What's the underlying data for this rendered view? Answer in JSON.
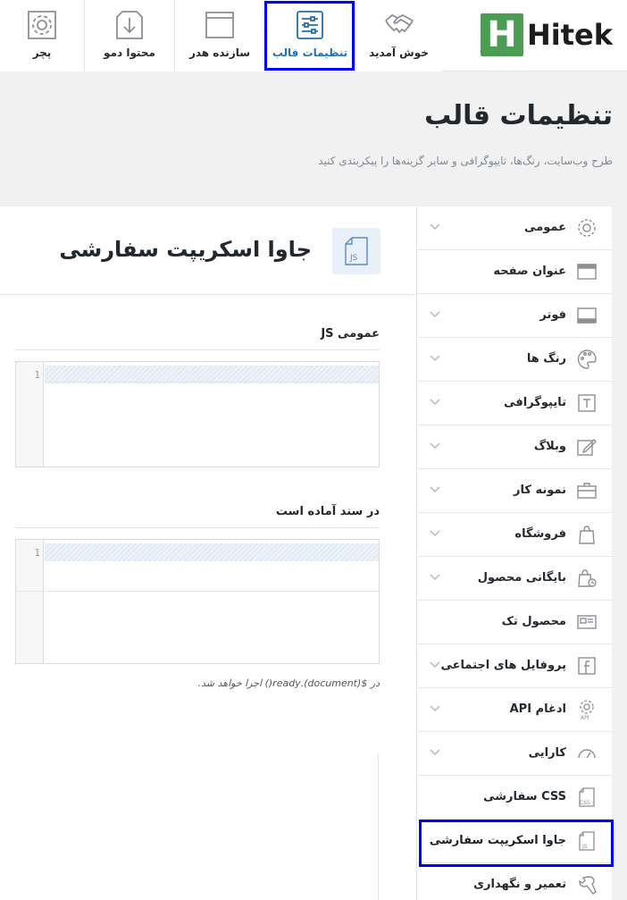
{
  "brand": {
    "logo_mark": "H",
    "logo_text": "Hitek",
    "color": "#4a9d52"
  },
  "nav": {
    "tabs": [
      {
        "id": "welcome",
        "label": "خوش آمدید",
        "icon": "handshake-icon"
      },
      {
        "id": "theme-settings",
        "label": "تنظیمات قالب",
        "icon": "sliders-icon",
        "active": true
      },
      {
        "id": "header-builder",
        "label": "سازنده هدر",
        "icon": "window-icon"
      },
      {
        "id": "demo-content",
        "label": "محتوا دمو",
        "icon": "download-icon"
      },
      {
        "id": "plugins",
        "label": "پچر",
        "icon": "gear-icon"
      }
    ]
  },
  "header": {
    "title": "تنظیمات قالب",
    "subtitle": "طرح وب‌سایت، رنگ‌ها، تایپوگرافی و سایر گزینه‌ها را پیکربندی کنید"
  },
  "panel": {
    "icon_text": "JS",
    "title": "جاوا اسکریپت سفارشی",
    "fields": [
      {
        "label": "عمومی JS",
        "line_number": "1"
      },
      {
        "label": "در سند آماده است",
        "line_number": "1"
      }
    ],
    "note": "در $(document).ready() اجرا خواهد شد."
  },
  "sidebar": {
    "items": [
      {
        "label": "عمومی",
        "icon": "gear-icon",
        "chevron": true
      },
      {
        "label": "عنوان صفحه",
        "icon": "title-bar-icon",
        "chevron": false
      },
      {
        "label": "فوتر",
        "icon": "footer-icon",
        "chevron": true
      },
      {
        "label": "رنگ ها",
        "icon": "palette-icon",
        "chevron": true
      },
      {
        "label": "تایپوگرافی",
        "icon": "typography-icon",
        "chevron": true
      },
      {
        "label": "وبلاگ",
        "icon": "edit-icon",
        "chevron": true
      },
      {
        "label": "نمونه کار",
        "icon": "briefcase-icon",
        "chevron": true
      },
      {
        "label": "فروشگاه",
        "icon": "shopping-bag-icon",
        "chevron": true
      },
      {
        "label": "بایگانی محصول",
        "icon": "archive-bag-icon",
        "chevron": true
      },
      {
        "label": "محصول تک",
        "icon": "product-card-icon",
        "chevron": true
      },
      {
        "label": "پروفایل های اجتماعی",
        "icon": "facebook-icon",
        "chevron": true
      },
      {
        "label": "ادغام API",
        "icon": "api-icon",
        "chevron": true
      },
      {
        "label": "کارایی",
        "icon": "speedometer-icon",
        "chevron": true
      },
      {
        "label": "CSS سفارشی",
        "icon": "css-file-icon",
        "chevron": false
      },
      {
        "label": "جاوا اسکریپت سفارشی",
        "icon": "js-file-icon",
        "chevron": false,
        "active": true
      },
      {
        "label": "تعمیر و نگهداری",
        "icon": "wrench-icon",
        "chevron": false
      }
    ]
  },
  "colors": {
    "accent": "#2271b1",
    "highlight": "#0000ff"
  }
}
